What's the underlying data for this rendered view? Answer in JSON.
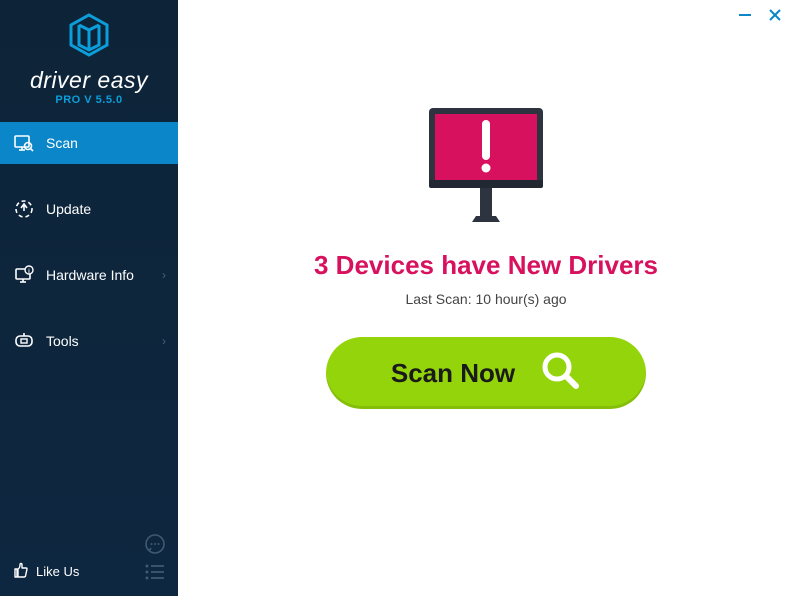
{
  "app": {
    "title": "driver easy",
    "version_label": "PRO V 5.5.0"
  },
  "sidebar": {
    "items": [
      {
        "label": "Scan",
        "active": true,
        "has_chevron": false
      },
      {
        "label": "Update",
        "active": false,
        "has_chevron": false
      },
      {
        "label": "Hardware Info",
        "active": false,
        "has_chevron": true
      },
      {
        "label": "Tools",
        "active": false,
        "has_chevron": true
      }
    ],
    "like_us": "Like Us"
  },
  "main": {
    "headline": "3 Devices have New Drivers",
    "last_scan": "Last Scan: 10 hour(s) ago",
    "scan_button": "Scan Now"
  },
  "colors": {
    "accent_blue": "#0b87c9",
    "accent_pink": "#d8115f",
    "accent_green": "#94d40a",
    "sidebar_bg": "#0d2438"
  }
}
